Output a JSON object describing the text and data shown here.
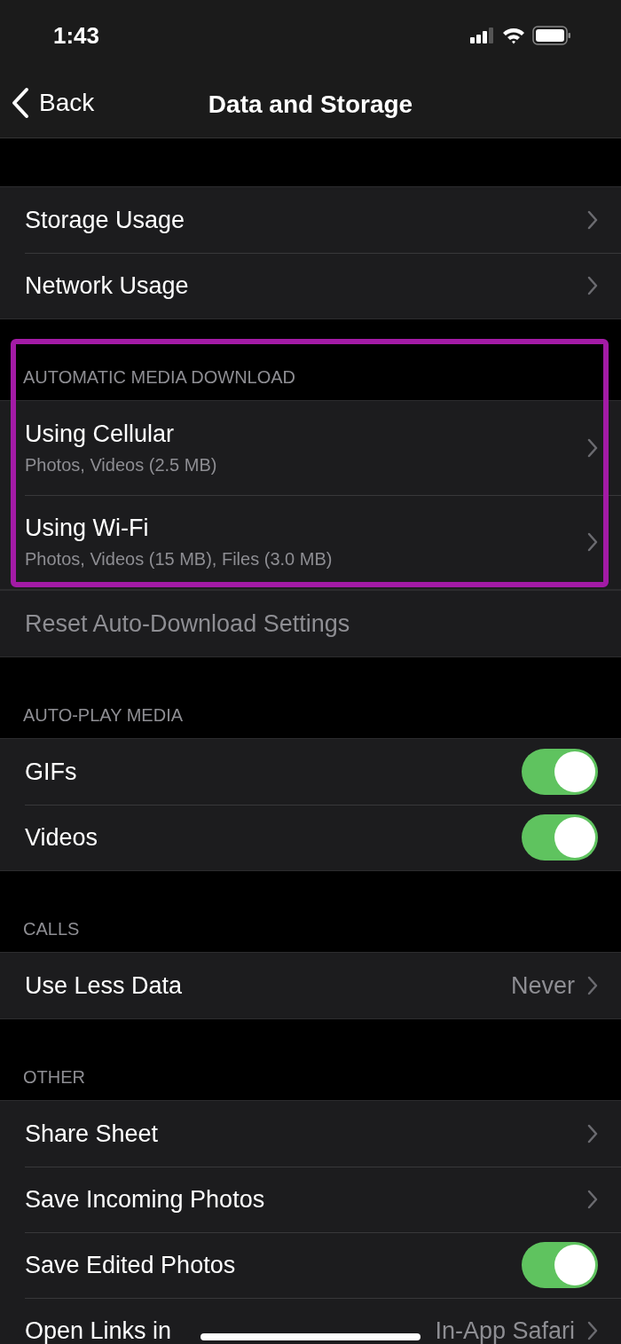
{
  "status_bar": {
    "time": "1:43"
  },
  "nav": {
    "back": "Back",
    "title": "Data and Storage"
  },
  "sections": [
    {
      "rows": [
        {
          "kind": "link",
          "label": "Storage Usage"
        },
        {
          "kind": "link",
          "label": "Network Usage"
        }
      ]
    },
    {
      "header": "AUTOMATIC MEDIA DOWNLOAD",
      "highlighted": true,
      "rows": [
        {
          "kind": "link",
          "label": "Using Cellular",
          "subtitle": "Photos, Videos (2.5 MB)"
        },
        {
          "kind": "link",
          "label": "Using Wi-Fi",
          "subtitle": "Photos, Videos (15 MB), Files (3.0 MB)"
        }
      ]
    },
    {
      "attached": true,
      "rows": [
        {
          "kind": "action",
          "label": "Reset Auto-Download Settings",
          "disabled": true
        }
      ]
    },
    {
      "header": "AUTO-PLAY MEDIA",
      "rows": [
        {
          "kind": "toggle",
          "label": "GIFs",
          "on": true
        },
        {
          "kind": "toggle",
          "label": "Videos",
          "on": true
        }
      ]
    },
    {
      "header": "CALLS",
      "rows": [
        {
          "kind": "value",
          "label": "Use Less Data",
          "value": "Never"
        }
      ]
    },
    {
      "header": "OTHER",
      "rows": [
        {
          "kind": "link",
          "label": "Share Sheet"
        },
        {
          "kind": "link",
          "label": "Save Incoming Photos"
        },
        {
          "kind": "toggle",
          "label": "Save Edited Photos",
          "on": true
        },
        {
          "kind": "value",
          "label": "Open Links in",
          "value": "In-App Safari"
        }
      ]
    }
  ]
}
